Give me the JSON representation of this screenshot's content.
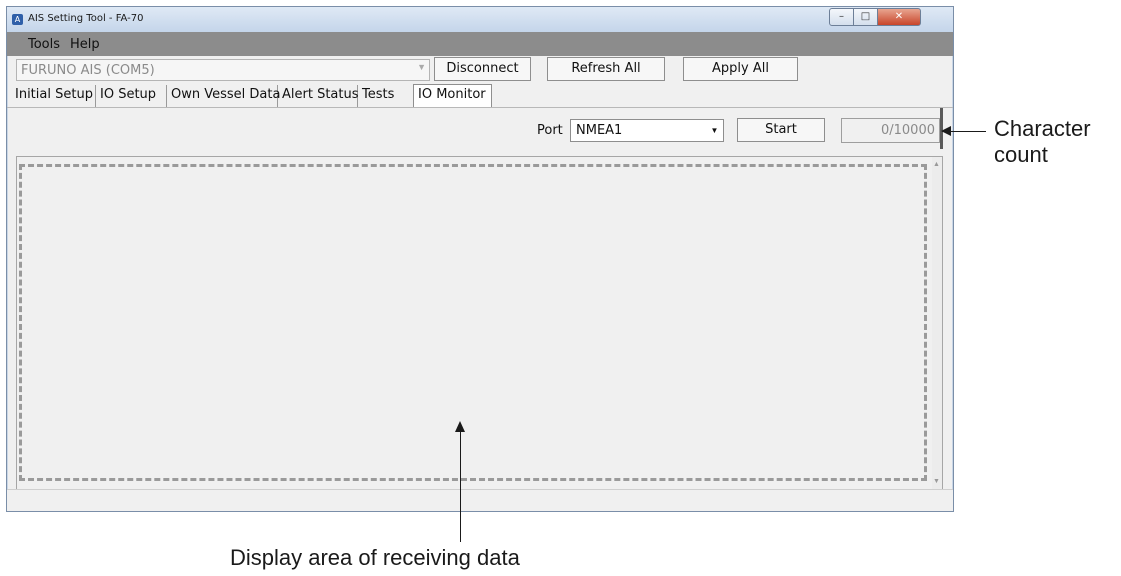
{
  "window": {
    "title": "AIS Setting Tool - FA-70",
    "app_icon_glyph": "A"
  },
  "menu": {
    "items": [
      "Tools",
      "Help"
    ]
  },
  "connection": {
    "device": "FURUNO AIS (COM5)",
    "disconnect_label": "Disconnect",
    "refresh_label": "Refresh All",
    "apply_label": "Apply All"
  },
  "tabs": [
    {
      "label": "Initial Setup",
      "active": false
    },
    {
      "label": "IO Setup",
      "active": false
    },
    {
      "label": "Own Vessel Data",
      "active": false
    },
    {
      "label": "Alert Status",
      "active": false
    },
    {
      "label": "Tests",
      "active": false
    },
    {
      "label": "IO Monitor",
      "active": true
    }
  ],
  "monitor": {
    "port_label": "Port",
    "port_value": "NMEA1",
    "start_label": "Start",
    "char_count": "0/10000"
  },
  "annotations": {
    "character_count_line1": "Character",
    "character_count_line2": "count",
    "display_area": "Display area of receiving data"
  },
  "colors": {
    "menubar": "#8c8c8c",
    "titlebar": "#c4d5ea",
    "window_bg": "#f0f0f0"
  },
  "icons": [
    "app-icon",
    "minimize-icon",
    "maximize-icon",
    "close-icon",
    "dropdown-arrow-icon",
    "scroll-up-icon",
    "scroll-down-icon"
  ]
}
